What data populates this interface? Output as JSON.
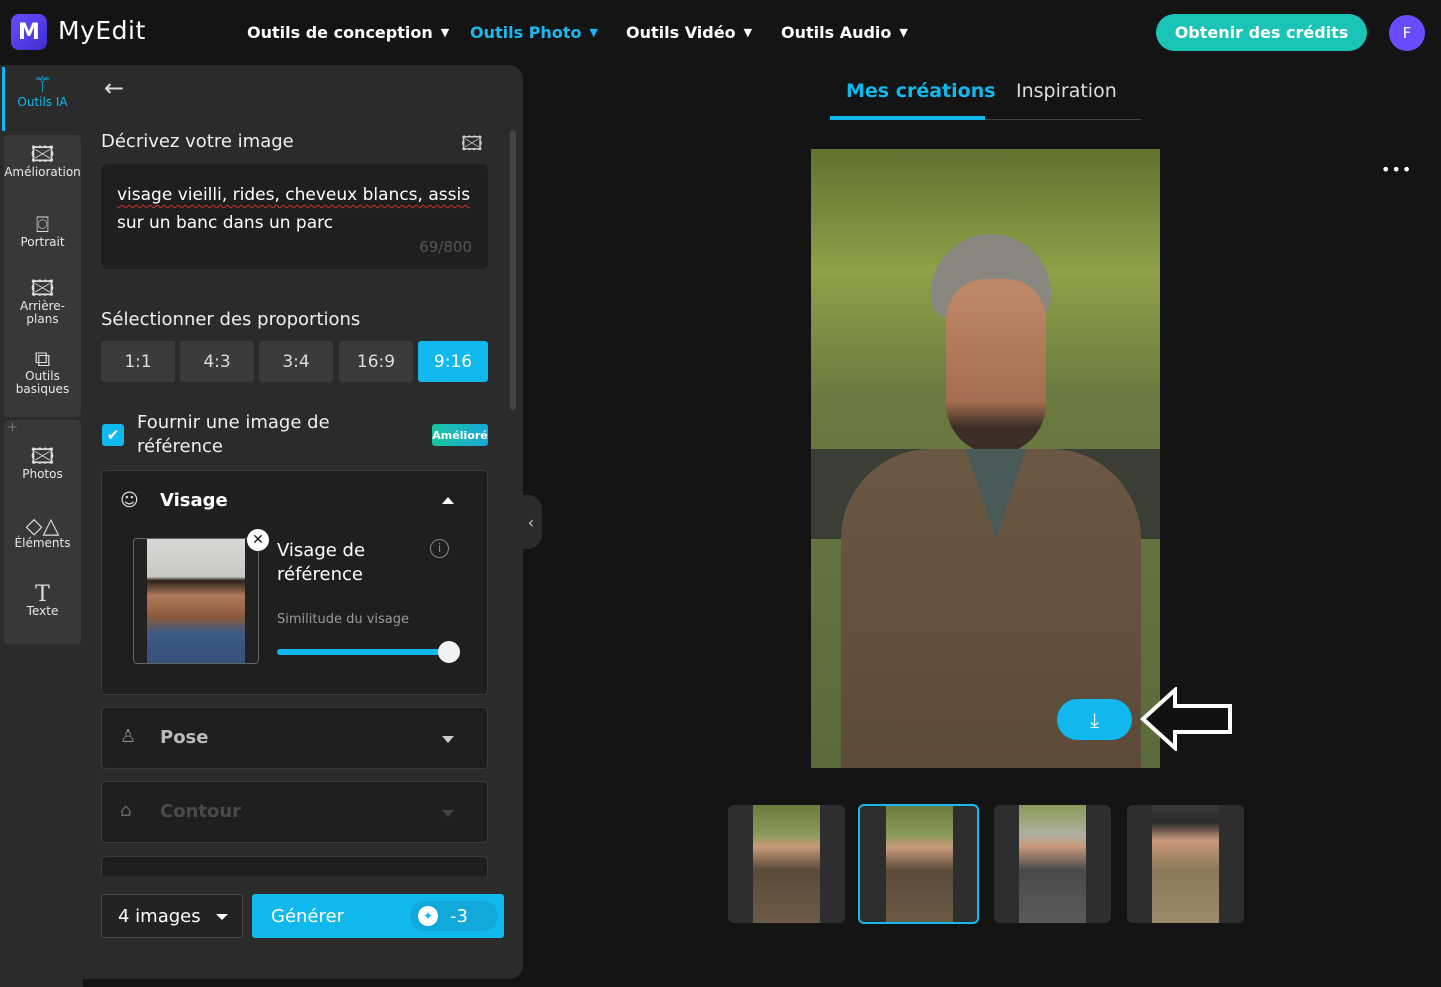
{
  "header": {
    "logo": "MyEdit",
    "nav": [
      "Outils de conception",
      "Outils Photo",
      "Outils Vidéo",
      "Outils Audio"
    ],
    "credits_button": "Obtenir des crédits",
    "avatar_initial": "F"
  },
  "rail": {
    "items": [
      "Outils IA",
      "Amélioration",
      "Portrait",
      "Arrière-plans",
      "Outils basiques",
      "Photos",
      "Éléments",
      "Texte"
    ]
  },
  "panel": {
    "describe_label": "Décrivez votre image",
    "prompt_line1": "visage vieilli, rides, cheveux blancs, assis",
    "prompt_line2": "sur un banc dans un parc",
    "char_count": "69/800",
    "ratio_label": "Sélectionner des proportions",
    "ratios": [
      "1:1",
      "4:3",
      "3:4",
      "16:9",
      "9:16"
    ],
    "selected_ratio": "9:16",
    "reference_line1": "Fournir une image de",
    "reference_line2": "référence",
    "reference_checked": true,
    "badge": "Amélioré",
    "visage": {
      "title": "Visage",
      "ref_line1": "Visage de",
      "ref_line2": "référence",
      "similarity_label": "Similitude du visage",
      "similarity": 1.0
    },
    "pose": "Pose",
    "contour": "Contour",
    "count_select": "4 images",
    "generate": "Générer",
    "cost": "-3"
  },
  "main": {
    "tabs": [
      "Mes créations",
      "Inspiration"
    ],
    "active_tab": "Mes créations",
    "more": "•••"
  },
  "colors": {
    "accent": "#10b8ee",
    "credits": "#1ac4b4",
    "brand": "#6a4cff"
  }
}
